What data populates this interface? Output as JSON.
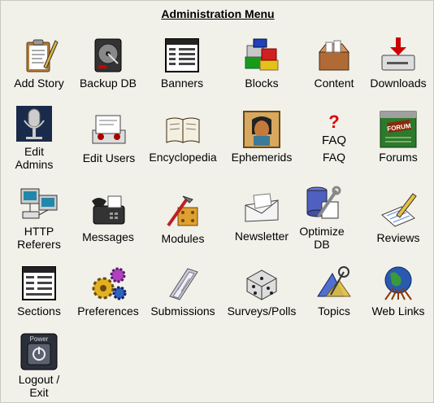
{
  "title": "Administration Menu",
  "items": [
    {
      "label": "Add Story",
      "icon": "clipboard-pencil-icon"
    },
    {
      "label": "Backup DB",
      "icon": "hard-drive-icon"
    },
    {
      "label": "Banners",
      "icon": "window-grid-icon"
    },
    {
      "label": "Blocks",
      "icon": "lego-blocks-icon"
    },
    {
      "label": "Content",
      "icon": "open-box-icon"
    },
    {
      "label": "Downloads",
      "icon": "download-drive-icon"
    },
    {
      "label": "Edit\nAdmins",
      "icon": "microphone-icon"
    },
    {
      "label": "Edit Users",
      "icon": "rolodex-icon"
    },
    {
      "label": "Encyclopedia",
      "icon": "open-book-icon"
    },
    {
      "label": "Ephemerids",
      "icon": "egyptian-portrait-icon"
    },
    {
      "label": "FAQ",
      "icon": "faq-question-icon",
      "icon_text": "FAQ",
      "icon_mark": "?"
    },
    {
      "label": "Forums",
      "icon": "forum-board-icon",
      "icon_text": "FORUM"
    },
    {
      "label": "HTTP\nReferers",
      "icon": "network-computers-icon"
    },
    {
      "label": "Messages",
      "icon": "fax-phone-icon"
    },
    {
      "label": "Modules",
      "icon": "tools-icon"
    },
    {
      "label": "Newsletter",
      "icon": "envelope-icon"
    },
    {
      "label": "Optimize\nDB",
      "icon": "database-wrench-icon"
    },
    {
      "label": "Reviews",
      "icon": "notepad-pencil-icon"
    },
    {
      "label": "Sections",
      "icon": "sections-window-icon"
    },
    {
      "label": "Preferences",
      "icon": "gears-icon"
    },
    {
      "label": "Submissions",
      "icon": "paper-stack-icon"
    },
    {
      "label": "Surveys/Polls",
      "icon": "dice-icon"
    },
    {
      "label": "Topics",
      "icon": "geometry-tools-icon"
    },
    {
      "label": "Web Links",
      "icon": "globe-network-icon"
    },
    {
      "label": "Logout /\nExit",
      "icon": "power-button-icon",
      "icon_text": "Power"
    }
  ]
}
